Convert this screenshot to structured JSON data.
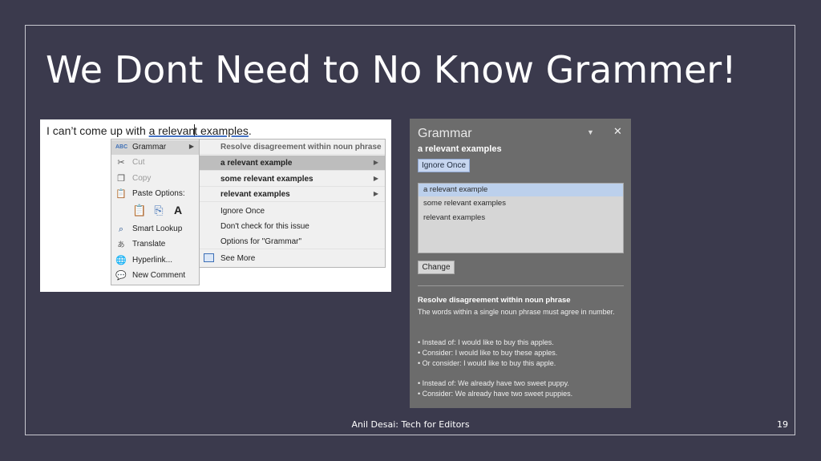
{
  "slide": {
    "title": "We Dont Need to No Know Grammer!",
    "footer": "Anil Desai: Tech for Editors",
    "page_number": "19"
  },
  "document": {
    "text_before": "I can’t come up with ",
    "text_underlined_a": "a relevan",
    "text_underlined_b": "t",
    "text_after": " examples",
    "text_period": "."
  },
  "context_menu": {
    "items": [
      {
        "label": "Grammar",
        "icon": "abc-grammar-icon"
      },
      {
        "label": "Cut",
        "icon": "scissors-icon"
      },
      {
        "label": "Copy",
        "icon": "copy-icon"
      },
      {
        "label": "Paste Options:",
        "icon": "clipboard-icon"
      },
      {
        "label": "Smart Lookup",
        "icon": "search-icon"
      },
      {
        "label": "Translate",
        "icon": "translate-icon"
      },
      {
        "label": "Hyperlink...",
        "icon": "globe-link-icon"
      },
      {
        "label": "New Comment",
        "icon": "comment-icon"
      }
    ]
  },
  "grammar_submenu": {
    "header": "Resolve disagreement within noun phrase",
    "suggestions": [
      "a relevant example",
      "some relevant examples",
      "relevant examples"
    ],
    "ignore_once": "Ignore Once",
    "dont_check": "Don't check for this issue",
    "options": "Options for \"Grammar\"",
    "see_more": "See More"
  },
  "grammar_pane": {
    "title": "Grammar",
    "flagged": "a relevant examples",
    "ignore_once": "Ignore Once",
    "suggestions": [
      "a relevant example",
      "some relevant examples",
      "relevant examples"
    ],
    "change": "Change",
    "explanation_title": "Resolve disagreement within noun phrase",
    "explanation_body": "The words within a single noun phrase must agree in number.",
    "examples": [
      "• Instead of: I would like to buy this apples.",
      "• Consider: I would like to buy these apples.",
      "• Or consider: I would like to buy this apple.",
      "• Instead of: We already have two sweet puppy.",
      "• Consider: We already have two sweet puppies."
    ]
  },
  "colors": {
    "slide_background": "#3b3a4d",
    "pane_background": "#6c6c6c",
    "selection_blue": "#bcd0ec"
  }
}
